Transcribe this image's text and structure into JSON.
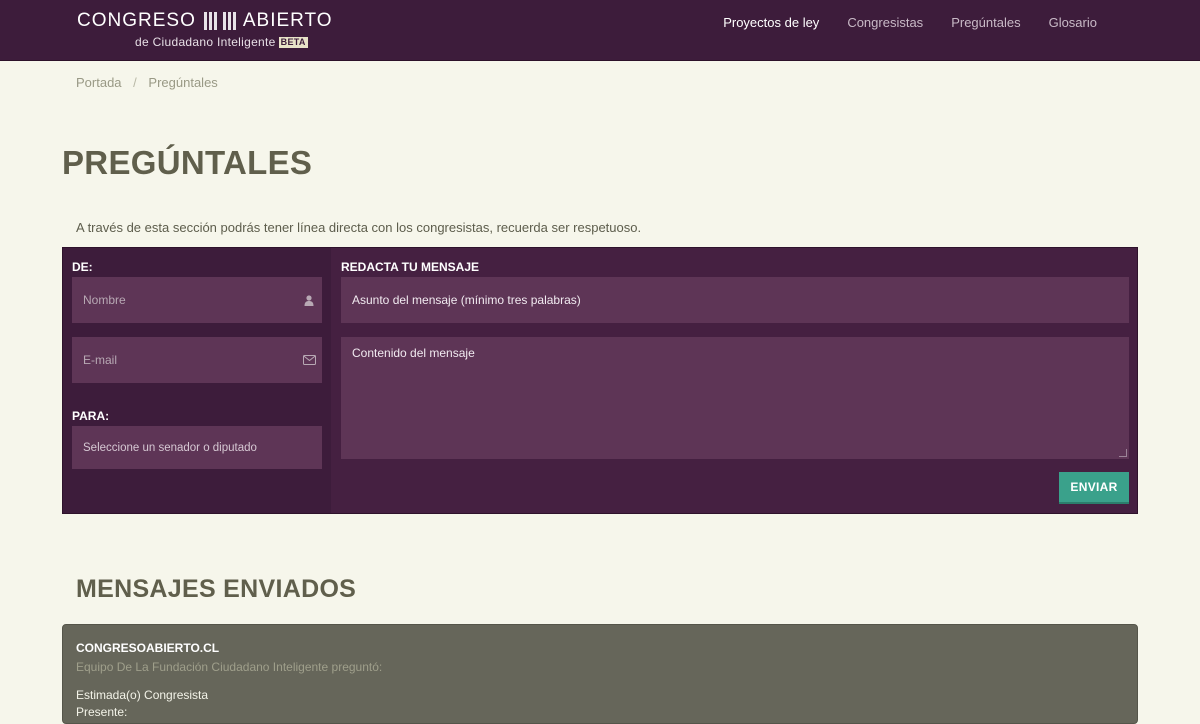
{
  "brand": {
    "title_left": "CONGRESO",
    "title_right": "ABIERTO",
    "subtitle": "de Ciudadano Inteligente",
    "badge": "BETA"
  },
  "nav": {
    "items": [
      {
        "label": "Proyectos de ley",
        "active": true
      },
      {
        "label": "Congresistas",
        "active": false
      },
      {
        "label": "Pregúntales",
        "active": false
      },
      {
        "label": "Glosario",
        "active": false
      }
    ]
  },
  "breadcrumb": {
    "items": [
      "Portada",
      "Pregúntales"
    ],
    "separator": "/"
  },
  "page": {
    "title": "PREGÚNTALES",
    "intro": "A través de esta sección podrás tener línea directa con los congresistas, recuerda ser respetuoso."
  },
  "form": {
    "from_label": "DE:",
    "name_placeholder": "Nombre",
    "name_icon": "user-icon",
    "email_placeholder": "E-mail",
    "email_icon": "envelope-icon",
    "to_label": "PARA:",
    "to_select": "Seleccione un senador o diputado",
    "compose_label": "REDACTA TU MENSAJE",
    "subject_placeholder": "Asunto del mensaje (mínimo tres palabras)",
    "content_placeholder": "Contenido del mensaje",
    "send_label": "ENVIAR"
  },
  "sent": {
    "title": "MENSAJES ENVIADOS",
    "messages": [
      {
        "from": "CONGRESOABIERTO.CL",
        "meta": "Equipo De La Fundación Ciudadano Inteligente preguntó:",
        "body_line1": "Estimada(o) Congresista",
        "body_line2": "Presente:"
      }
    ]
  },
  "colors": {
    "navbar": "#3d1c3b",
    "panel": "#452041",
    "field": "#5e3556",
    "accent": "#3aa18b",
    "background": "#f6f6eb",
    "card": "#66665a"
  }
}
